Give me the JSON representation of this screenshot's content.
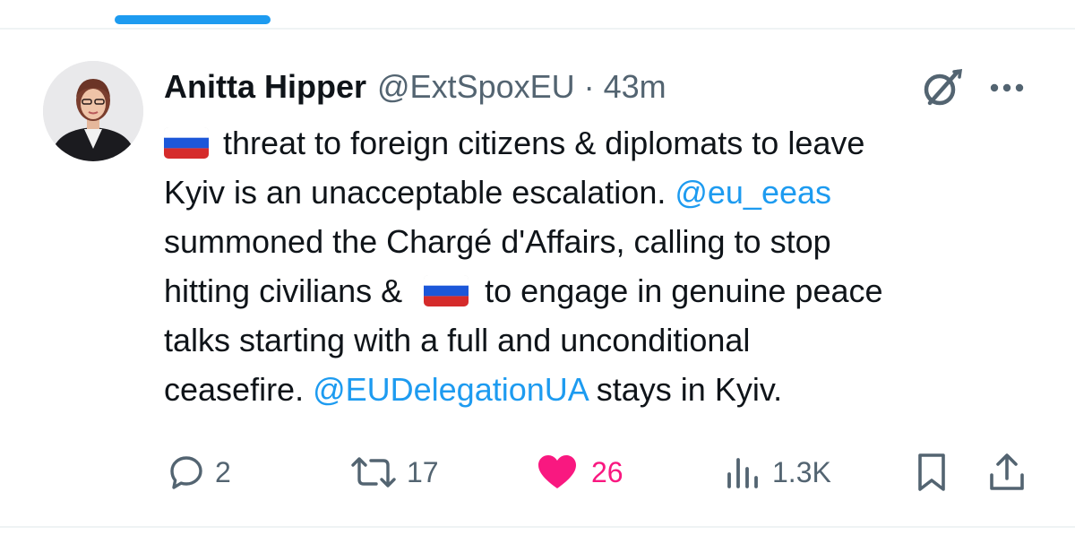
{
  "tweet": {
    "author": {
      "display_name": "Anitta Hipper",
      "handle": "@ExtSpoxEU",
      "separator": "·",
      "time": "43m"
    },
    "text_lines": [
      {
        "segments": [
          {
            "type": "flag",
            "icon": "russia-flag"
          },
          {
            "type": "text",
            "text": "threat to foreign citizens & diplomats to leave"
          }
        ]
      },
      {
        "segments": [
          {
            "type": "text",
            "text": "Kyiv is an unacceptable escalation. "
          },
          {
            "type": "mention",
            "text": "@eu_eeas"
          }
        ]
      },
      {
        "segments": [
          {
            "type": "text",
            "text": "summoned the Chargé d'Affairs, calling to stop"
          }
        ]
      },
      {
        "segments": [
          {
            "type": "text",
            "text": "hitting civilians &"
          },
          {
            "type": "flag",
            "icon": "russia-flag"
          },
          {
            "type": "text",
            "text": "to engage in genuine peace"
          }
        ]
      },
      {
        "segments": [
          {
            "type": "text",
            "text": "talks starting with a full and unconditional"
          }
        ]
      },
      {
        "segments": [
          {
            "type": "text",
            "text": "ceasefire. "
          },
          {
            "type": "mention",
            "text": "@EUDelegationUA"
          },
          {
            "type": "text",
            "text": " stays in Kyiv."
          }
        ]
      }
    ],
    "metrics": {
      "replies": "2",
      "reposts": "17",
      "likes": "26",
      "views": "1.3K"
    }
  },
  "icons": {
    "grok": "grok-icon",
    "more": "more-icon",
    "reply": "reply-icon",
    "repost": "repost-icon",
    "like": "heart-icon",
    "views": "views-icon",
    "bookmark": "bookmark-icon",
    "share": "share-icon"
  },
  "colors": {
    "accent": "#1d9bf0",
    "like_active": "#f91880",
    "secondary_text": "#536471",
    "primary_text": "#0f1419"
  }
}
